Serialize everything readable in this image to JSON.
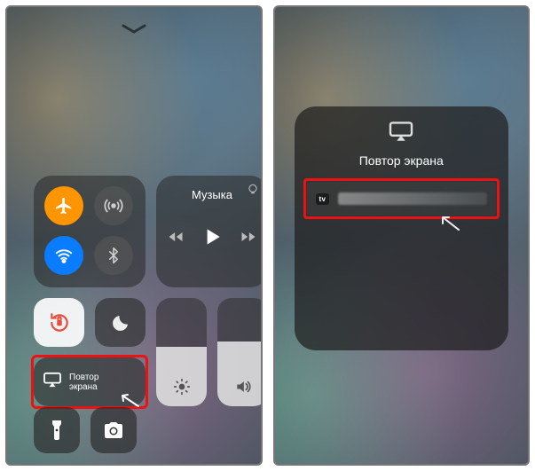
{
  "left": {
    "music_label": "Музыка",
    "mirror_label": "Повтор\nэкрана"
  },
  "right": {
    "sheet_title": "Повтор экрана",
    "atv_badge": "tv"
  },
  "icons": {
    "airplane": "airplane-icon",
    "cellular": "cellular-icon",
    "wifi": "wifi-icon",
    "bluetooth": "bluetooth-icon",
    "lock_rotation": "rotation-lock-icon",
    "dnd": "do-not-disturb-icon",
    "airplay": "airplay-icon",
    "brightness": "brightness-icon",
    "volume": "volume-icon",
    "flashlight": "flashlight-icon",
    "camera": "camera-icon",
    "rewind": "rewind-icon",
    "play": "play-icon",
    "forward": "forward-icon"
  },
  "colors": {
    "highlight": "#e11",
    "airplane_bg": "#ff9500",
    "wifi_bg": "#0a7cff"
  }
}
